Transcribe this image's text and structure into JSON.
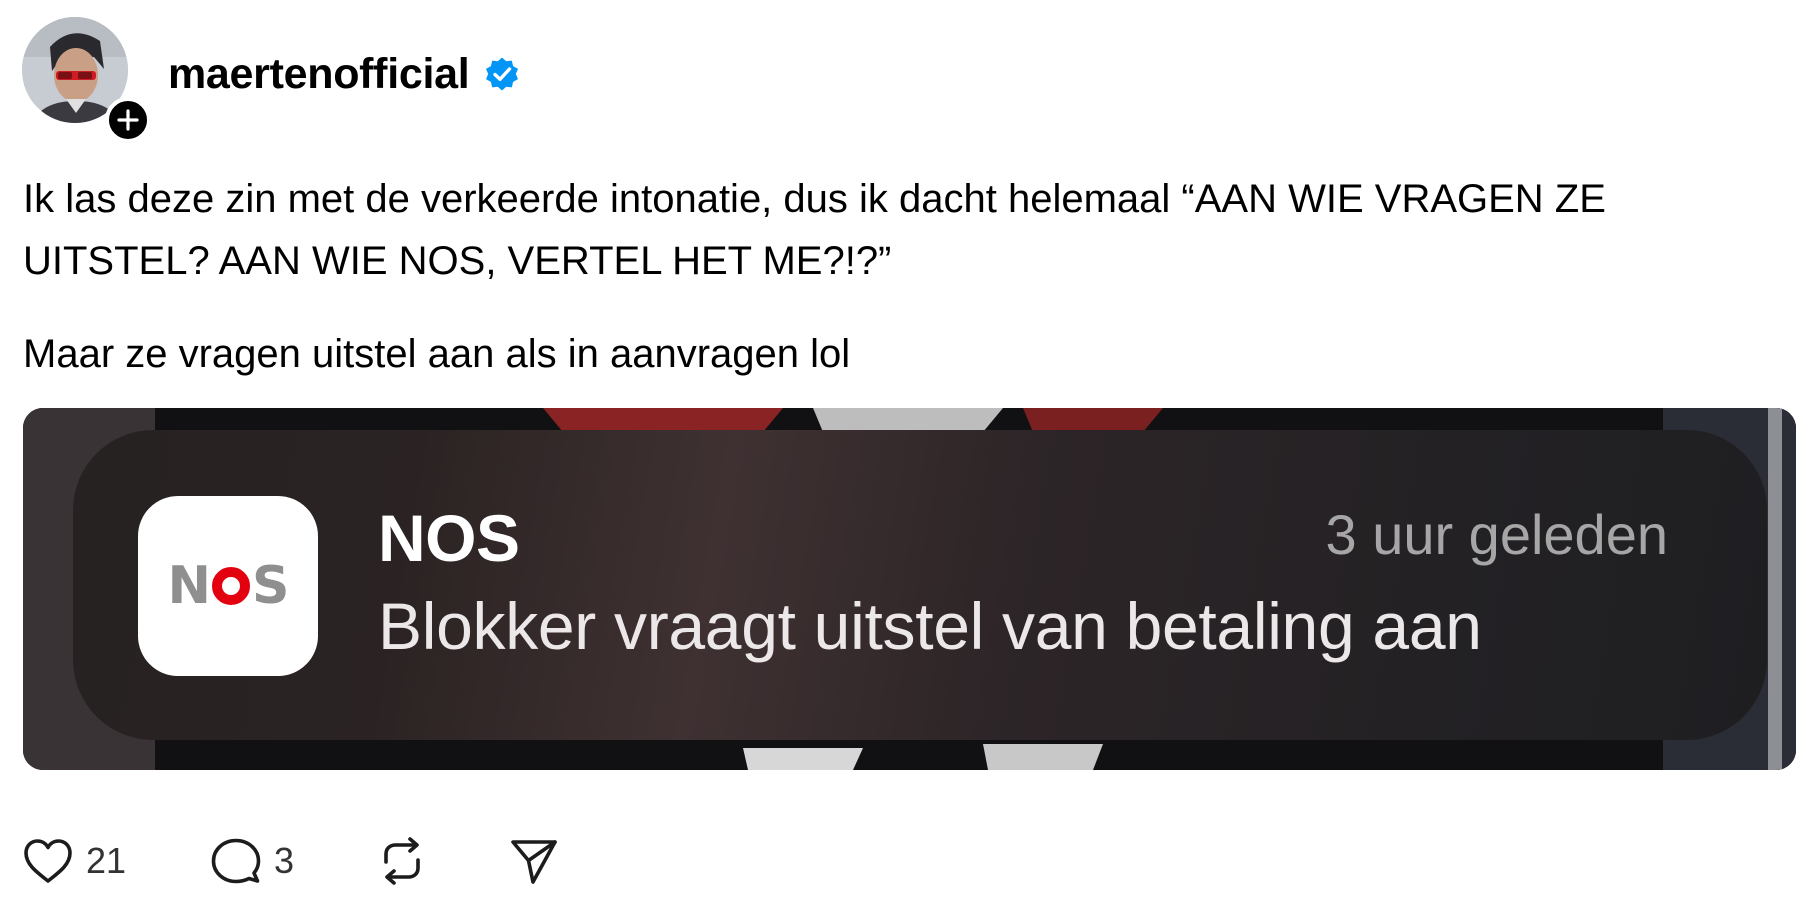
{
  "post": {
    "author": {
      "username": "maertenofficial",
      "verified": true,
      "avatar_icon": "avatar",
      "follow_icon": "plus-icon"
    },
    "text_paragraphs": [
      "Ik las deze zin met de verkeerde intonatie, dus ik dacht helemaal “AAN WIE VRAGEN ZE UITSTEL? AAN WIE NOS, VERTEL HET ME?!?”",
      "Maar ze vragen uitstel aan als in aanvragen lol"
    ],
    "media": {
      "notification": {
        "app_icon_text": "NOS",
        "app_name": "NOS",
        "time": "3 uur geleden",
        "message": "Blokker vraagt uitstel van betaling aan"
      }
    },
    "actions": {
      "like_count": "21",
      "reply_count": "3",
      "like_icon": "heart-icon",
      "reply_icon": "comment-bubble-icon",
      "repost_icon": "repost-icon",
      "share_icon": "send-icon"
    },
    "colors": {
      "verified_badge": "#0095f6",
      "nos_red": "#e3000f"
    }
  }
}
